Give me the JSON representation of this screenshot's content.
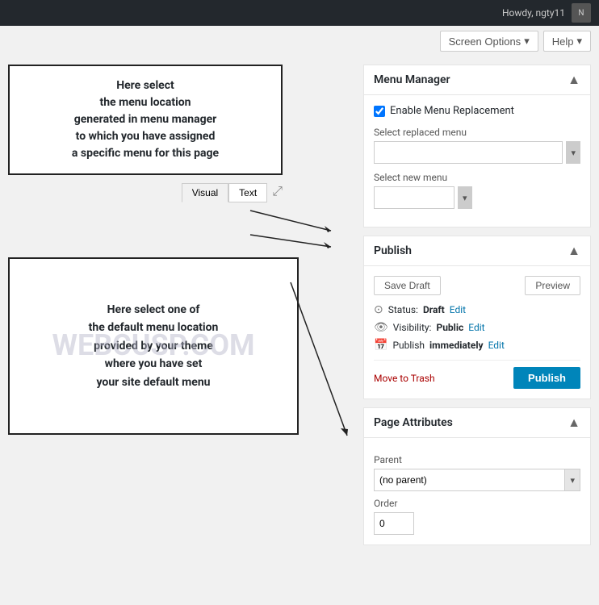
{
  "adminBar": {
    "howdy": "Howdy, ngty11",
    "avatarInitial": "N"
  },
  "topBar": {
    "screenOptions": "Screen Options",
    "help": "Help",
    "dropdownArrow": "▾"
  },
  "annotations": {
    "topBoxText": "Here select\nthe menu location\ngenerated in menu manager\nto which you have assigned\na specific menu for this page",
    "bottomBoxText": "Here select one of\nthe default menu location\nprovided by your theme\nwhere you have set\nyour site default menu",
    "watermark": "WEBCUSP.COM"
  },
  "editor": {
    "tab_visual": "Visual",
    "tab_text": "Text",
    "expandIcon": "⤢"
  },
  "menuManager": {
    "panelTitle": "Menu Manager",
    "toggleArrow": "▲",
    "checkboxLabel": "Enable Menu Replacement",
    "checkboxChecked": true,
    "selectReplacedMenuLabel": "Select replaced menu",
    "selectReplacedMenuPlaceholder": "",
    "selectNewMenuLabel": "Select new menu",
    "selectNewMenuPlaceholder": "",
    "dropdownArrow": "▾"
  },
  "publish": {
    "panelTitle": "Publish",
    "toggleArrow": "▲",
    "saveDraftLabel": "Save Draft",
    "previewLabel": "Preview",
    "statusLabel": "Status:",
    "statusValue": "Draft",
    "statusEdit": "Edit",
    "visibilityLabel": "Visibility:",
    "visibilityValue": "Public",
    "visibilityEdit": "Edit",
    "publishLabel": "Publish",
    "publishValue": "immediately",
    "publishEdit": "Edit",
    "moveToTrash": "Move to Trash",
    "publishButton": "Publish"
  },
  "pageAttributes": {
    "panelTitle": "Page Attributes",
    "toggleArrow": "▲",
    "parentLabel": "Parent",
    "parentValue": "(no parent)",
    "parentDropdownArrow": "▾",
    "orderLabel": "Order",
    "orderValue": "0"
  }
}
